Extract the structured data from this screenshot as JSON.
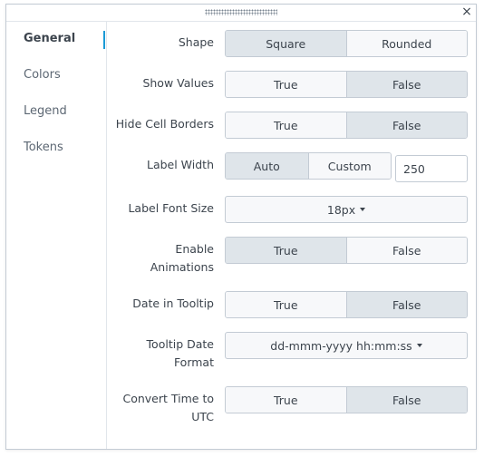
{
  "window": {
    "close_glyph": "×",
    "drag_icon": "drag-handle-icon",
    "close_icon": "close-icon"
  },
  "sidebar": {
    "items": [
      {
        "label": "General",
        "active": true
      },
      {
        "label": "Colors",
        "active": false
      },
      {
        "label": "Legend",
        "active": false
      },
      {
        "label": "Tokens",
        "active": false
      }
    ]
  },
  "settings": {
    "shape": {
      "label": "Shape",
      "options": [
        "Square",
        "Rounded"
      ],
      "selected": "Square"
    },
    "show_values": {
      "label": "Show Values",
      "options": [
        "True",
        "False"
      ],
      "selected": "False"
    },
    "hide_cell_borders": {
      "label": "Hide Cell Borders",
      "options": [
        "True",
        "False"
      ],
      "selected": "False"
    },
    "label_width": {
      "label": "Label Width",
      "options": [
        "Auto",
        "Custom"
      ],
      "selected": "Auto",
      "value": "250"
    },
    "label_font_size": {
      "label": "Label Font Size",
      "value": "18px"
    },
    "enable_animations": {
      "label_line1": "Enable",
      "label_line2": "Animations",
      "options": [
        "True",
        "False"
      ],
      "selected": "True"
    },
    "date_in_tooltip": {
      "label": "Date in Tooltip",
      "options": [
        "True",
        "False"
      ],
      "selected": "False"
    },
    "tooltip_date_format": {
      "label_line1": "Tooltip Date",
      "label_line2": "Format",
      "value": "dd-mmm-yyyy hh:mm:ss"
    },
    "convert_time_utc": {
      "label_line1": "Convert Time to",
      "label_line2": "UTC",
      "options": [
        "True",
        "False"
      ],
      "selected": "False"
    }
  },
  "colors": {
    "accent": "#1a9ad6",
    "selected_bg": "#dfe5ea",
    "unselected_bg": "#f7f8fa",
    "border": "#c3cbd4",
    "text": "#3c444d"
  }
}
